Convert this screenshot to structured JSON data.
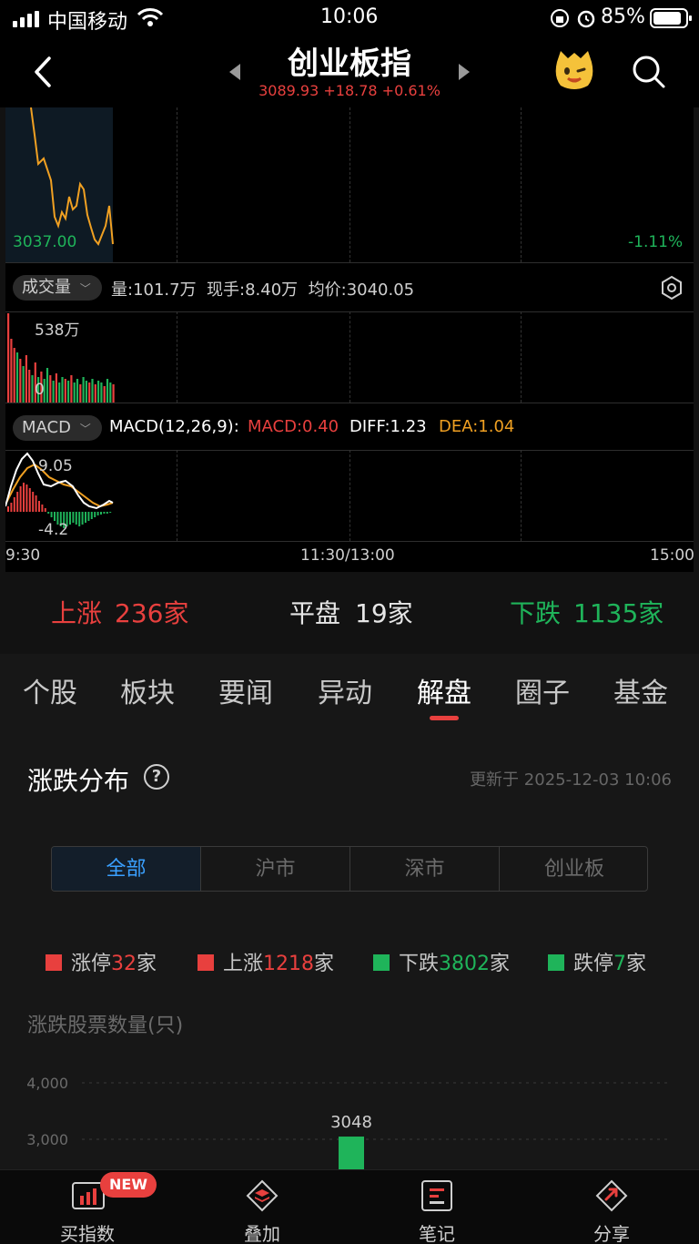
{
  "status_bar": {
    "carrier": "中国移动",
    "time": "10:06",
    "battery_pct": "85%"
  },
  "nav": {
    "title": "创业板指",
    "quote": "3089.93 +18.78 +0.61%"
  },
  "chart": {
    "price_low_label": "3037.00",
    "pct_label": "-1.11%",
    "volume_selector": "成交量",
    "volume_info": "量:101.7万  现手:8.40万  均价:3040.05",
    "volume_max": "538万",
    "volume_zero": "0",
    "macd_selector": "MACD",
    "macd_params": "MACD(12,26,9):",
    "macd_value": "MACD:0.40",
    "diff_value": "DIFF:1.23",
    "dea_value": "DEA:1.04",
    "macd_top": "9.05",
    "macd_bottom": "-4.2",
    "time_start": "9:30",
    "time_mid": "11:30/13:00",
    "time_end": "15:00"
  },
  "breadth": {
    "up_label": "上涨",
    "up_count": "236家",
    "flat_label": "平盘",
    "flat_count": "19家",
    "down_label": "下跌",
    "down_count": "1135家"
  },
  "tabs": [
    "个股",
    "板块",
    "要闻",
    "异动",
    "解盘",
    "圈子",
    "基金"
  ],
  "active_tab": "解盘",
  "distribution": {
    "title": "涨跌分布",
    "updated": "更新于 2025-12-03 10:06",
    "segments": [
      "全部",
      "沪市",
      "深市",
      "创业板"
    ],
    "legend": [
      {
        "label": "涨停",
        "count": "32",
        "unit": "家",
        "color": "#e8403e"
      },
      {
        "label": "上涨",
        "count": "1218",
        "unit": "家",
        "color": "#e8403e"
      },
      {
        "label": "下跌",
        "count": "3802",
        "unit": "家",
        "color": "#1fb45a"
      },
      {
        "label": "跌停",
        "count": "7",
        "unit": "家",
        "color": "#1fb45a"
      }
    ],
    "chart_title": "涨跌股票数量(只)"
  },
  "chart_data": {
    "type": "bar",
    "title": "涨跌股票数量(只)",
    "yticks": [
      "4,000",
      "3,000"
    ],
    "ylim": [
      2500,
      4000
    ],
    "values": [
      3048
    ],
    "value_labels": [
      "3048"
    ],
    "bar_color": "#1fb45a"
  },
  "bottom_bar": {
    "items": [
      "买指数",
      "叠加",
      "笔记",
      "分享"
    ],
    "badge": "NEW"
  },
  "colors": {
    "up": "#e8403e",
    "down": "#1fb45a",
    "accent": "#3aa0ff",
    "dea": "#f0a022"
  }
}
